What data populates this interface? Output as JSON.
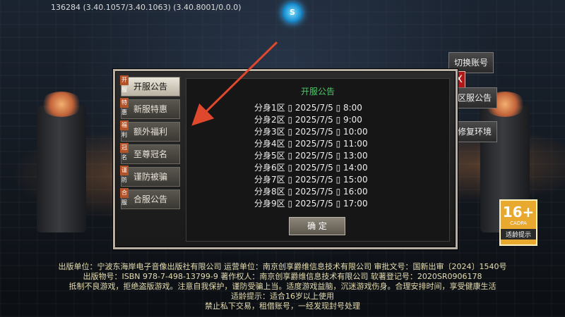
{
  "header": {
    "version": "136284 (3.40.1057/3.40.1063) (3.40.8001/0.0.0)",
    "logo_text": "S"
  },
  "side_buttons": {
    "switch_account": "切换账号",
    "close": "X",
    "server_notice": "区服公告",
    "repair_env": "修复环境"
  },
  "tabs": [
    {
      "label": "开服公告",
      "badge": "开服",
      "active": true
    },
    {
      "label": "新服特惠",
      "badge": "特惠",
      "active": false
    },
    {
      "label": "额外福利",
      "badge": "福利",
      "active": false
    },
    {
      "label": "至尊冠名",
      "badge": "冠名",
      "active": false
    },
    {
      "label": "谨防被骗",
      "badge": "谨防",
      "active": false
    },
    {
      "label": "合服公告",
      "badge": "合服",
      "active": false
    }
  ],
  "content": {
    "title": "开服公告",
    "rows": [
      "分身1区 ▯ 2025/7/5 ▯ 8:00",
      "分身2区 ▯ 2025/7/5 ▯ 9:00",
      "分身3区 ▯ 2025/7/5 ▯ 10:00",
      "分身4区 ▯ 2025/7/5 ▯ 11:00",
      "分身5区 ▯ 2025/7/5 ▯ 13:00",
      "分身6区 ▯ 2025/7/5 ▯ 14:00",
      "分身7区 ▯ 2025/7/5 ▯ 15:00",
      "分身8区 ▯ 2025/7/5 ▯ 16:00",
      "分身9区 ▯ 2025/7/5 ▯ 17:00"
    ],
    "ok_label": "确 定"
  },
  "age_badge": {
    "age": "16+",
    "org": "CADPA",
    "tip": "适龄提示"
  },
  "footer": {
    "line1": "出版单位：宁波东海岸电子音像出版社有限公司 运营单位：南京创享爵维信息技术有限公司 审批文号：国新出审〔2024〕1540号",
    "line2": "出版物号：ISBN 978-7-498-13799-9 著作权人：南京创享爵维信息技术有限公司 软著登记号：2020SR0906178",
    "line3": "抵制不良游戏，拒绝盗版游戏。注意自我保护，谨防受骗上当。适度游戏益脑，沉迷游戏伤身。合理安排时间，享受健康生活",
    "line4": "适龄提示：适合16岁以上使用",
    "line5": "禁止私下交易，租借账号，一经发现封号处理"
  },
  "colors": {
    "title_green": "#52c46c",
    "arrow_red": "#e0482e",
    "age_orange": "#e8a92e"
  }
}
